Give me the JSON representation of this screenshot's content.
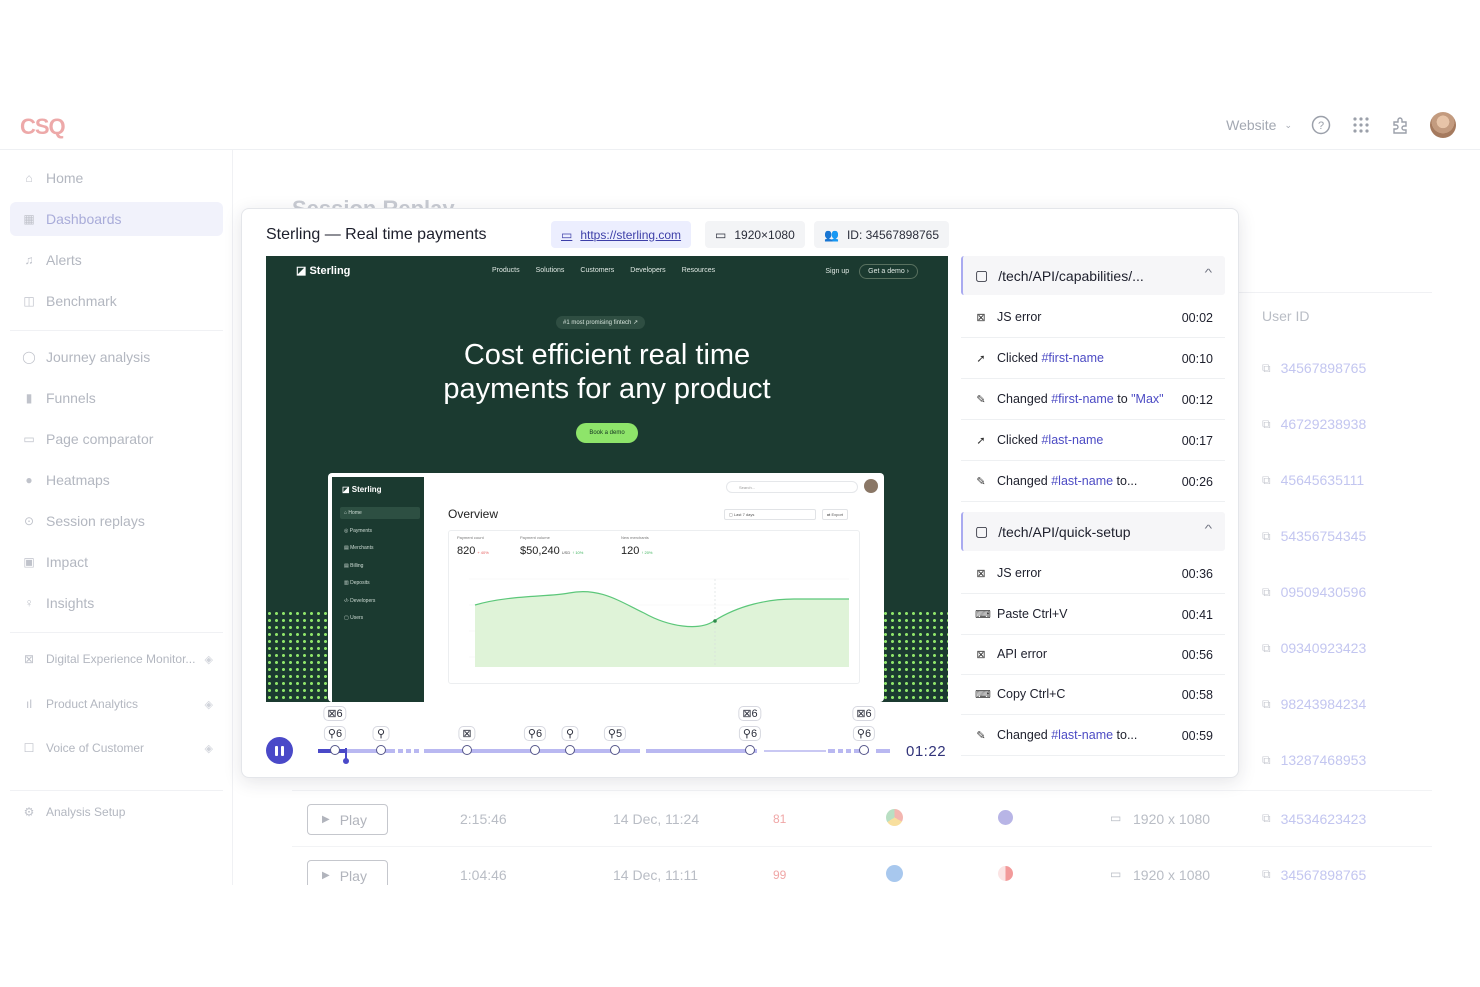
{
  "app": {
    "logo": "CSQ",
    "topbar": {
      "site_select": "Website"
    },
    "sidebar": {
      "items": [
        {
          "label": "Home",
          "icon": "home-icon"
        },
        {
          "label": "Dashboards",
          "icon": "dashboard-icon",
          "active": true
        },
        {
          "label": "Alerts",
          "icon": "bell-icon"
        },
        {
          "label": "Benchmark",
          "icon": "benchmark-icon"
        },
        {
          "label": "Journey analysis",
          "icon": "journey-icon"
        },
        {
          "label": "Funnels",
          "icon": "funnel-icon"
        },
        {
          "label": "Page comparator",
          "icon": "compare-icon"
        },
        {
          "label": "Heatmaps",
          "icon": "heatmap-icon"
        },
        {
          "label": "Session replays",
          "icon": "play-circle-icon"
        },
        {
          "label": "Impact",
          "icon": "impact-icon"
        },
        {
          "label": "Insights",
          "icon": "bulb-icon"
        },
        {
          "label": "Digital Experience Monitor...",
          "icon": "monitor-icon"
        },
        {
          "label": "Product Analytics",
          "icon": "analytics-icon"
        },
        {
          "label": "Voice of Customer",
          "icon": "voc-icon"
        },
        {
          "label": "Analysis Setup",
          "icon": "setup-icon"
        }
      ]
    },
    "background": {
      "page_title": "Session Replay",
      "user_id_header": "User ID",
      "user_ids": [
        "34567898765",
        "46729238938",
        "45645635111",
        "54356754345",
        "09509430596",
        "09340923423",
        "98243984234",
        "13287468953"
      ],
      "rows": [
        {
          "play": "Play",
          "duration": "2:15:46",
          "date": "14 Dec, 11:24",
          "score": "81",
          "resolution": "1920 x 1080",
          "user_id": "34534623423"
        },
        {
          "play": "Play",
          "duration": "1:04:46",
          "date": "14 Dec, 11:11",
          "score": "99",
          "resolution": "1920 x 1080",
          "user_id": "34567898765"
        }
      ]
    }
  },
  "modal": {
    "title": "Sterling — Real time payments",
    "url": "https://sterling.com",
    "resolution": "1920×1080",
    "session_id": "ID: 34567898765",
    "replay": {
      "site_logo": "Sterling",
      "nav_links": [
        "Products",
        "Solutions",
        "Customers",
        "Developers",
        "Resources"
      ],
      "sign_up": "Sign up",
      "get_demo": "Get a demo",
      "badge": "#1 most promising fintech ↗",
      "hero_line1": "Cost efficient real time",
      "hero_line2": "payments for any product",
      "cta": "Book a demo",
      "dashboard": {
        "logo": "Sterling",
        "menu": [
          "Home",
          "Payments",
          "Merchants",
          "Billing",
          "Deposits",
          "Developers",
          "Users"
        ],
        "overview": "Overview",
        "search": "Search...",
        "range": "Last 7 days",
        "export": "Export",
        "stats": [
          {
            "label": "Payment count",
            "value": "820",
            "delta": "+ 40%"
          },
          {
            "label": "Payment volume",
            "value": "$50,240",
            "unit": "USD",
            "delta": "↑ 10%"
          },
          {
            "label": "New merchants",
            "value": "120",
            "delta": "↑ 20%"
          }
        ]
      }
    },
    "timeline": {
      "elapsed": "01:22",
      "progress": 0.048,
      "tags_top": [
        {
          "text": "⊠6",
          "pos": 0.03
        },
        {
          "text": "⊠6",
          "pos": 0.755
        },
        {
          "text": "⊠6",
          "pos": 0.955
        }
      ],
      "tags_bottom": [
        {
          "text": "⚲6",
          "pos": 0.03
        },
        {
          "text": "⚲",
          "pos": 0.11
        },
        {
          "text": "⊠",
          "pos": 0.26
        },
        {
          "text": "⚲6",
          "pos": 0.38
        },
        {
          "text": "⚲",
          "pos": 0.44
        },
        {
          "text": "⚲5",
          "pos": 0.52
        },
        {
          "text": "⚲6",
          "pos": 0.755
        },
        {
          "text": "⚲6",
          "pos": 0.955
        }
      ]
    },
    "events": {
      "groups": [
        {
          "path": "/tech/API/capabilities/...",
          "items": [
            {
              "icon": "error-icon",
              "glyph": "⊠",
              "label": "JS error",
              "time": "00:02"
            },
            {
              "icon": "cursor-icon",
              "glyph": "➚",
              "label": "Clicked ",
              "selector": "#first-name",
              "time": "00:10"
            },
            {
              "icon": "pencil-icon",
              "glyph": "✎",
              "label": "Changed ",
              "selector": "#first-name",
              "suffix": " to ",
              "value": "\"Max\"",
              "time": "00:12"
            },
            {
              "icon": "cursor-icon",
              "glyph": "➚",
              "label": "Clicked ",
              "selector": "#last-name",
              "time": "00:17"
            },
            {
              "icon": "pencil-icon",
              "glyph": "✎",
              "label": "Changed ",
              "selector": "#last-name",
              "suffix": " to...",
              "time": "00:26"
            }
          ]
        },
        {
          "path": "/tech/API/quick-setup",
          "items": [
            {
              "icon": "error-icon",
              "glyph": "⊠",
              "label": "JS error",
              "time": "00:36"
            },
            {
              "icon": "keyboard-icon",
              "glyph": "⌨",
              "label": "Paste Ctrl+V",
              "time": "00:41"
            },
            {
              "icon": "error-icon",
              "glyph": "⊠",
              "label": "API error",
              "time": "00:56"
            },
            {
              "icon": "keyboard-icon",
              "glyph": "⌨",
              "label": "Copy Ctrl+C",
              "time": "00:58"
            },
            {
              "icon": "pencil-icon",
              "glyph": "✎",
              "label": "Changed ",
              "selector": "#last-name",
              "suffix": " to...",
              "time": "00:59"
            }
          ]
        }
      ]
    }
  }
}
